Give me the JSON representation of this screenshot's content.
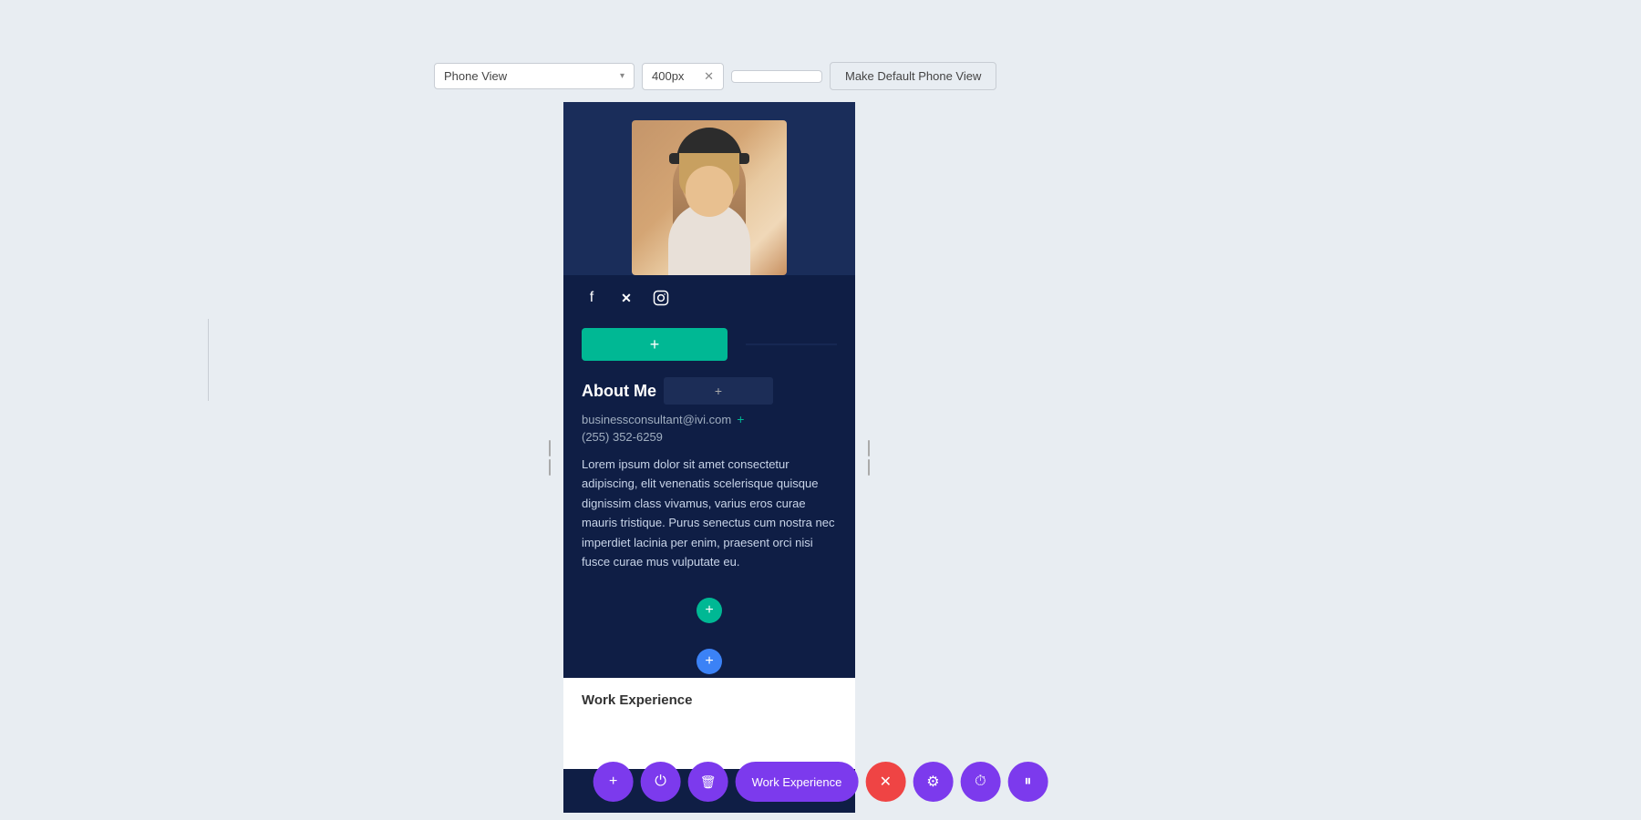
{
  "toolbar": {
    "view_label": "Phone View",
    "px_value": "400px",
    "make_default_label": "Make Default Phone View"
  },
  "preview": {
    "profile_image_alt": "Profile photo of woman with hat",
    "social_icons": [
      "f",
      "𝕏",
      "⬡"
    ],
    "add_section_label": "+",
    "about_title": "About Me",
    "add_inline_label": "+",
    "email": "businessconsultant@ivi.com",
    "phone": "(255) 352-6259",
    "lorem_text": "Lorem ipsum dolor sit amet consectetur adipiscing, elit venenatis scelerisque quisque dignissim class vivamus, varius eros curae mauris tristique. Purus senectus cum nostra nec imperdiet lacinia per enim, praesent orci nisi fusce curae mus vulputate eu.",
    "work_exp_label": "Work Experience"
  },
  "floating_toolbar": {
    "add_label": "+",
    "power_label": "⏻",
    "trash_label": "🗑",
    "section_label": "Work Experience",
    "close_label": "✕",
    "gear_label": "⚙",
    "clock_label": "⏱",
    "pause_label": "⏸"
  }
}
